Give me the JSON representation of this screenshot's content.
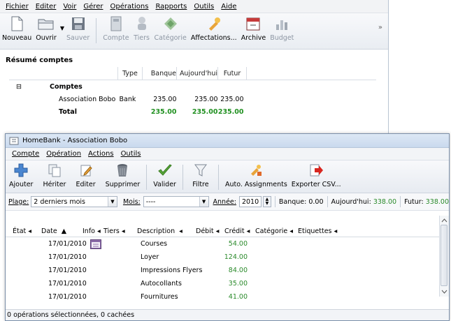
{
  "back_window": {
    "menu": [
      "Fichier",
      "Editer",
      "Voir",
      "Gérer",
      "Opérations",
      "Rapports",
      "Outils",
      "Aide"
    ],
    "toolbar": {
      "nouveau": "Nouveau",
      "ouvrir": "Ouvrir",
      "sauver": "Sauver",
      "compte": "Compte",
      "tiers": "Tiers",
      "categorie": "Catégorie",
      "affectations": "Affectations...",
      "archive": "Archive",
      "budget": "Budget",
      "overflow": "»"
    },
    "summary": {
      "title": "Résumé comptes",
      "headers": {
        "type": "Type",
        "banque": "Banque",
        "aujourdhui": "Aujourd'hui",
        "futur": "Futur"
      },
      "group": {
        "toggle": "⊟",
        "name": "Comptes"
      },
      "account": {
        "name": "Association Bobo",
        "type": "Bank",
        "banque": "235.00",
        "aujourdhui": "235.00",
        "futur": "235.00"
      },
      "total": {
        "label": "Total",
        "banque": "235.00",
        "aujourdhui": "235.00",
        "futur": "235.00"
      }
    }
  },
  "front_window": {
    "title": "HomeBank - Association Bobo",
    "menu": [
      "Compte",
      "Opération",
      "Actions",
      "Outils"
    ],
    "toolbar": {
      "ajouter": "Ajouter",
      "heriter": "Hériter",
      "editer": "Editer",
      "supprimer": "Supprimer",
      "valider": "Valider",
      "filtre": "Filtre",
      "auto": "Auto. Assignments",
      "export": "Exporter CSV..."
    },
    "filter": {
      "plage_label": "Plage:",
      "plage_value": "2 derniers mois",
      "mois_label": "Mois:",
      "mois_value": "----",
      "annee_label": "Année:",
      "annee_value": "2010",
      "banque": "Banque: 0.00",
      "aujourdhui": "Aujourd'hui: 338.00",
      "futur": "Futur: 338.00",
      "banque_label": "Banque:",
      "banque_value": "0.00",
      "aujourdhui_label": "Aujourd'hui:",
      "aujourdhui_value": "338.00",
      "futur_label": "Futur:",
      "futur_value": "338.00"
    },
    "columns": [
      "État",
      "Date",
      "Info",
      "Tiers",
      "Description",
      "Débit",
      "Crédit",
      "Catégorie",
      "Etiquettes"
    ],
    "rows": [
      {
        "date": "17/01/2010",
        "description": "Courses",
        "credit": "54.00",
        "info_icon": "calendar-icon"
      },
      {
        "date": "17/01/2010",
        "description": "Loyer",
        "credit": "124.00"
      },
      {
        "date": "17/01/2010",
        "description": "Impressions Flyers",
        "credit": "84.00"
      },
      {
        "date": "17/01/2010",
        "description": "Autocollants",
        "credit": "35.00"
      },
      {
        "date": "17/01/2010",
        "description": "Fournitures",
        "credit": "41.00"
      }
    ],
    "status": "0 opérations sélectionnées, 0 cachées"
  }
}
